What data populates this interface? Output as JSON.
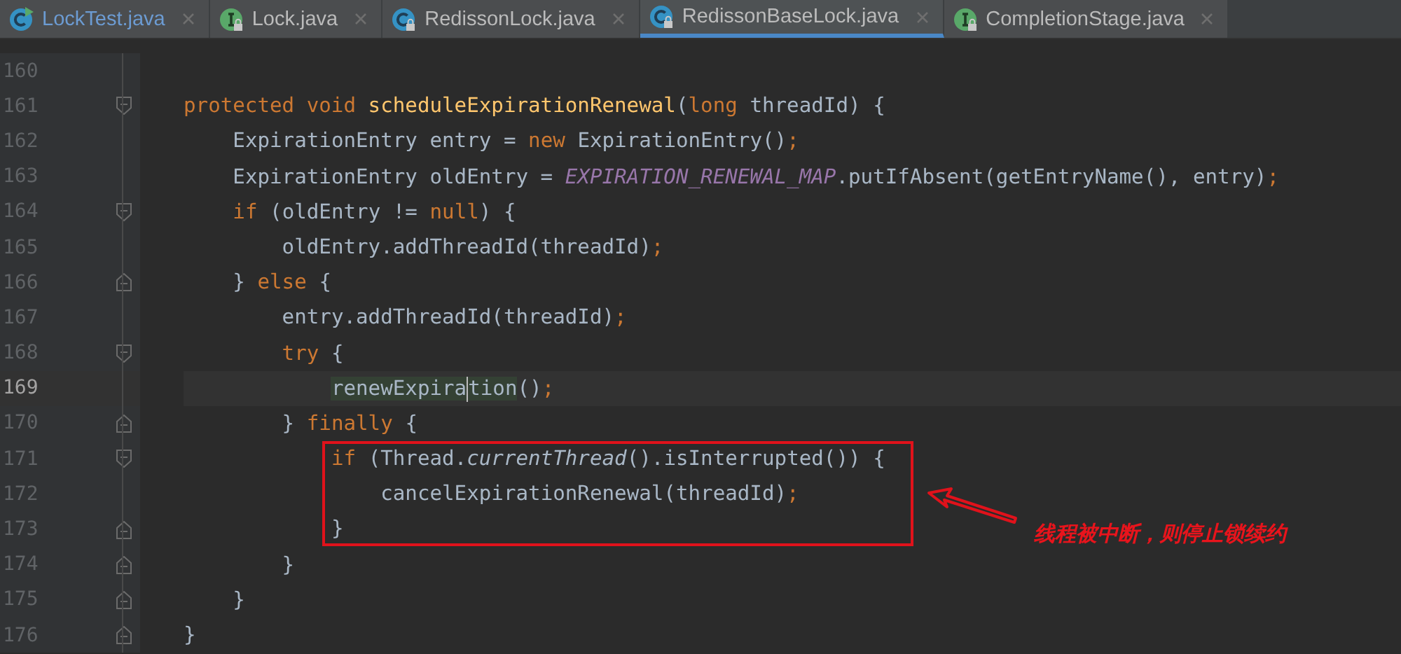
{
  "tabs": [
    {
      "label": "LockTest.java",
      "kind": "test-class",
      "locked": false,
      "modified": true,
      "selected": false
    },
    {
      "label": "Lock.java",
      "kind": "interface",
      "locked": true,
      "modified": false,
      "selected": false
    },
    {
      "label": "RedissonLock.java",
      "kind": "class",
      "locked": true,
      "modified": false,
      "selected": false
    },
    {
      "label": "RedissonBaseLock.java",
      "kind": "class",
      "locked": true,
      "modified": false,
      "selected": true
    },
    {
      "label": "CompletionStage.java",
      "kind": "interface",
      "locked": true,
      "modified": false,
      "selected": false
    }
  ],
  "editor": {
    "lines": [
      {
        "number": "160",
        "current": false,
        "kind": "plain"
      },
      {
        "number": "161",
        "current": false,
        "kind": "fold-start",
        "tokens": [
          {
            "kind": "keyword",
            "text": "protected void "
          },
          {
            "kind": "declaration",
            "text": "scheduleExpirationRenewal"
          },
          {
            "kind": "plain",
            "text": "("
          },
          {
            "kind": "keyword",
            "text": "long"
          },
          {
            "kind": "plain",
            "text": " threadId) {"
          }
        ]
      },
      {
        "number": "162",
        "current": false,
        "kind": "plain",
        "tokens": [
          {
            "kind": "plain",
            "text": "    ExpirationEntry entry = "
          },
          {
            "kind": "keyword",
            "text": "new"
          },
          {
            "kind": "plain",
            "text": " ExpirationEntry()"
          },
          {
            "kind": "semicolon",
            "text": ";"
          }
        ]
      },
      {
        "number": "163",
        "current": false,
        "kind": "plain",
        "tokens": [
          {
            "kind": "plain",
            "text": "    ExpirationEntry oldEntry = "
          },
          {
            "kind": "static",
            "text": "EXPIRATION_RENEWAL_MAP"
          },
          {
            "kind": "plain",
            "text": ".putIfAbsent(getEntryName(), entry)"
          },
          {
            "kind": "semicolon",
            "text": ";"
          }
        ]
      },
      {
        "number": "164",
        "current": false,
        "kind": "fold-start",
        "tokens": [
          {
            "kind": "keyword",
            "text": "    if"
          },
          {
            "kind": "plain",
            "text": " (oldEntry != "
          },
          {
            "kind": "keyword",
            "text": "null"
          },
          {
            "kind": "plain",
            "text": ") {"
          }
        ]
      },
      {
        "number": "165",
        "current": false,
        "kind": "plain",
        "tokens": [
          {
            "kind": "plain",
            "text": "        oldEntry.addThreadId(threadId)"
          },
          {
            "kind": "semicolon",
            "text": ";"
          }
        ]
      },
      {
        "number": "166",
        "current": false,
        "kind": "fold-end",
        "tokens": [
          {
            "kind": "plain",
            "text": "    } "
          },
          {
            "kind": "keyword",
            "text": "else"
          },
          {
            "kind": "plain",
            "text": " {"
          }
        ]
      },
      {
        "number": "167",
        "current": false,
        "kind": "plain",
        "tokens": [
          {
            "kind": "plain",
            "text": "        entry.addThreadId(threadId)"
          },
          {
            "kind": "semicolon",
            "text": ";"
          }
        ]
      },
      {
        "number": "168",
        "current": false,
        "kind": "fold-start",
        "tokens": [
          {
            "kind": "keyword",
            "text": "        try"
          },
          {
            "kind": "plain",
            "text": " {"
          }
        ]
      },
      {
        "number": "169",
        "current": true,
        "kind": "plain",
        "tokens": [
          {
            "kind": "usage",
            "text": "            renewExpira",
            "caret": true
          },
          {
            "kind": "usage",
            "text": "tion",
            "caret": false
          },
          {
            "kind": "plain",
            "text": "()"
          },
          {
            "kind": "semicolon",
            "text": ";"
          }
        ]
      },
      {
        "number": "170",
        "current": false,
        "kind": "fold-end",
        "tokens": [
          {
            "kind": "plain",
            "text": "        } "
          },
          {
            "kind": "keyword",
            "text": "finally"
          },
          {
            "kind": "plain",
            "text": " {"
          }
        ]
      },
      {
        "number": "171",
        "current": false,
        "kind": "fold-start",
        "tokens": [
          {
            "kind": "keyword",
            "text": "            if"
          },
          {
            "kind": "plain",
            "text": " (Thread."
          },
          {
            "kind": "static-call",
            "text": "currentThread"
          },
          {
            "kind": "plain",
            "text": "().isInterrupted()) {"
          }
        ]
      },
      {
        "number": "172",
        "current": false,
        "kind": "plain",
        "tokens": [
          {
            "kind": "plain",
            "text": "                cancelExpirationRenewal(threadId)"
          },
          {
            "kind": "semicolon",
            "text": ";"
          }
        ]
      },
      {
        "number": "173",
        "current": false,
        "kind": "fold-end",
        "tokens": [
          {
            "kind": "plain",
            "text": "            }"
          }
        ]
      },
      {
        "number": "174",
        "current": false,
        "kind": "fold-end",
        "tokens": [
          {
            "kind": "plain",
            "text": "        }"
          }
        ]
      },
      {
        "number": "175",
        "current": false,
        "kind": "fold-end",
        "tokens": [
          {
            "kind": "plain",
            "text": "    }"
          }
        ]
      },
      {
        "number": "176",
        "current": false,
        "kind": "fold-end",
        "tokens": [
          {
            "kind": "plain",
            "text": "}"
          }
        ]
      }
    ]
  },
  "annotation": {
    "text": "线程被中断，则停止锁续约"
  }
}
